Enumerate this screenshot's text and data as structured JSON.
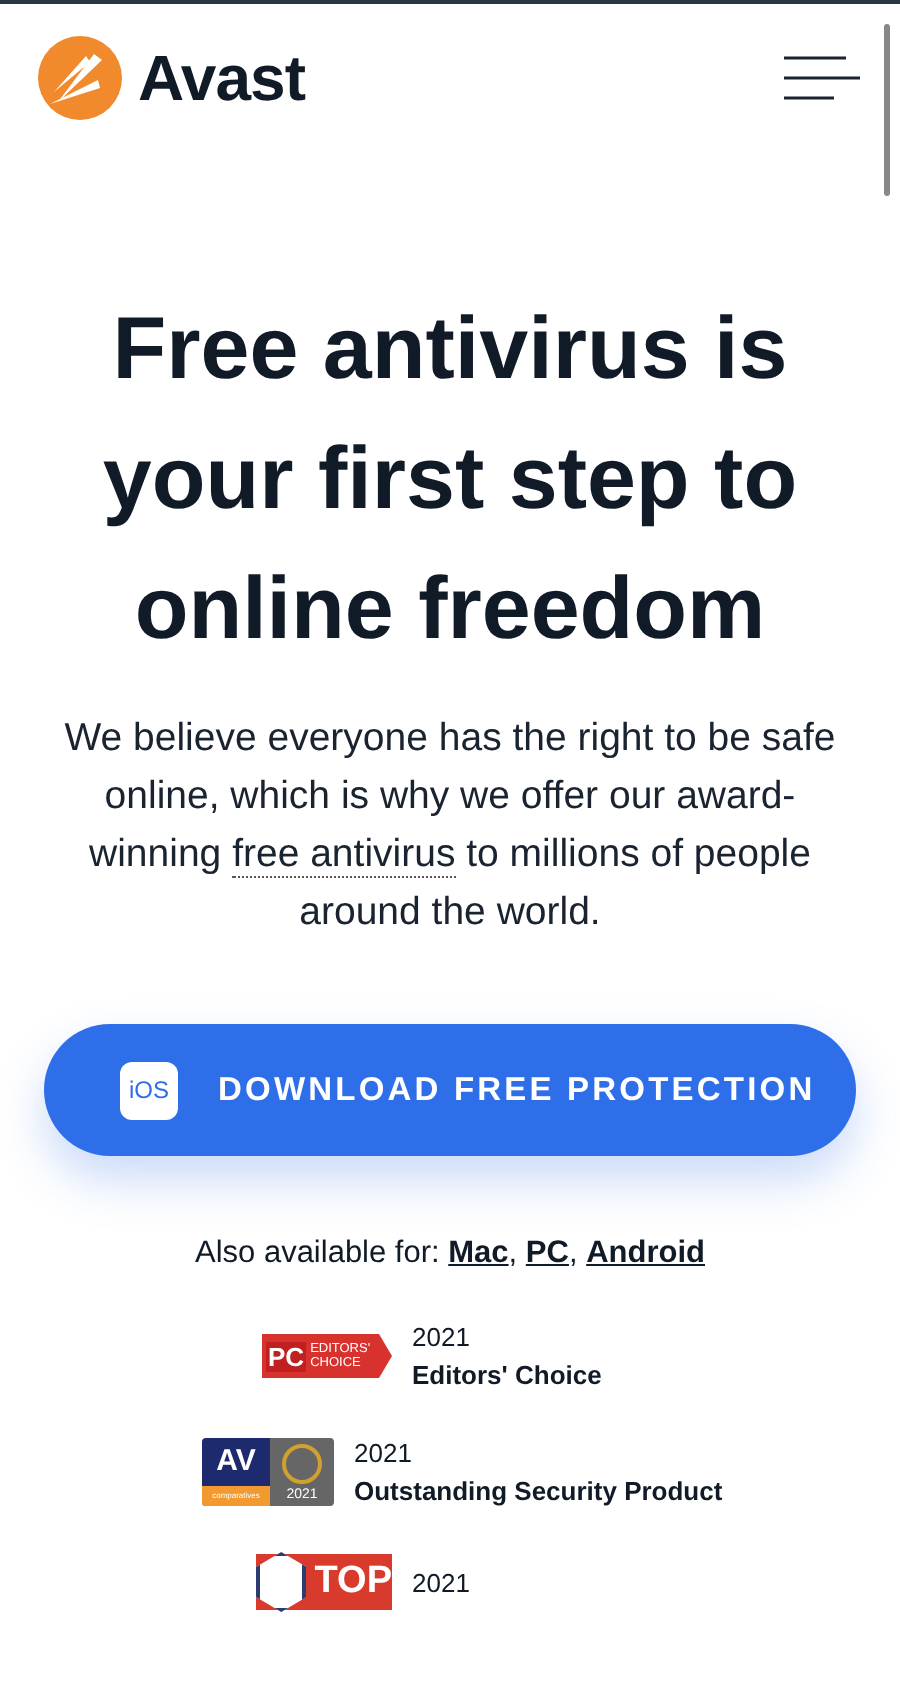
{
  "header": {
    "brand": "Avast"
  },
  "hero": {
    "title": "Free antivirus is your first step to online freedom",
    "intro_before": "We believe everyone has the right to be safe online, which is why we offer our award-winning ",
    "intro_link": "free antivirus",
    "intro_after": " to millions of people around the world."
  },
  "download_button": {
    "badge": "iOS",
    "label": "DOWNLOAD FREE PROTECTION"
  },
  "also_available": {
    "label": "Also available for:",
    "links": [
      "Mac",
      "PC",
      "Android"
    ],
    "separator": ","
  },
  "awards": [
    {
      "kind": "pc",
      "badge_texts": [
        "PC",
        "EDITORS' CHOICE"
      ],
      "year": "2021",
      "title": "Editors' Choice"
    },
    {
      "kind": "av",
      "badge_texts": [
        "AV",
        "comparatives",
        "2021"
      ],
      "year": "2021",
      "title": "Outstanding Security Product"
    },
    {
      "kind": "top",
      "badge_texts": [
        "TOP"
      ],
      "year": "2021"
    }
  ]
}
